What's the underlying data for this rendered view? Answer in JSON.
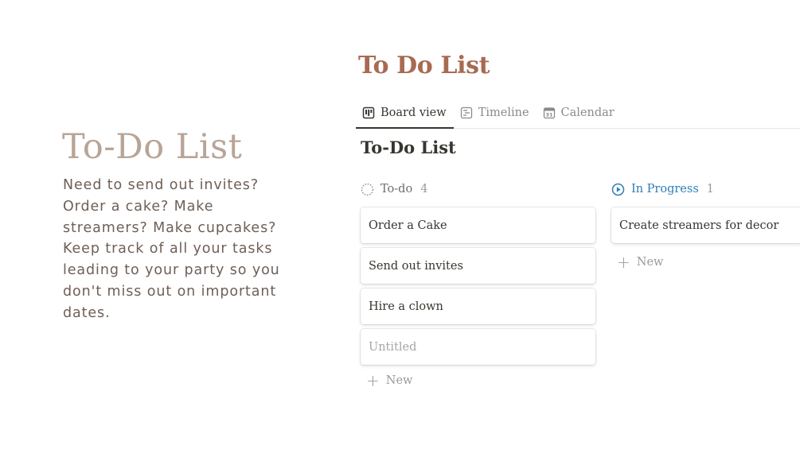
{
  "promo": {
    "title": "To-Do List",
    "body": "Need to send out invites? Order a cake? Make streamers? Make cupcakes? Keep track of all your tasks leading to your party so you don't miss out on important dates."
  },
  "page": {
    "title": "To Do List",
    "tabs": [
      {
        "label": "Board view",
        "icon": "board-icon",
        "active": true
      },
      {
        "label": "Timeline",
        "icon": "timeline-icon",
        "active": false
      },
      {
        "label": "Calendar",
        "icon": "calendar-icon",
        "active": false
      }
    ],
    "board_title": "To-Do List"
  },
  "columns": {
    "todo": {
      "label": "To-do",
      "count": "4",
      "icon": "dotted-circle-icon",
      "color": "#6f6e69",
      "cards": [
        "Order a Cake",
        "Send out invites",
        "Hire a clown",
        "Untitled"
      ],
      "new_label": "New"
    },
    "progress": {
      "label": "In Progress",
      "count": "1",
      "icon": "play-circle-icon",
      "color": "#2f7db8",
      "cards": [
        "Create streamers for decor"
      ],
      "new_label": "New"
    }
  },
  "colors": {
    "promo_title": "#b8a497",
    "page_title": "#a86a52",
    "text": "#37352f"
  }
}
